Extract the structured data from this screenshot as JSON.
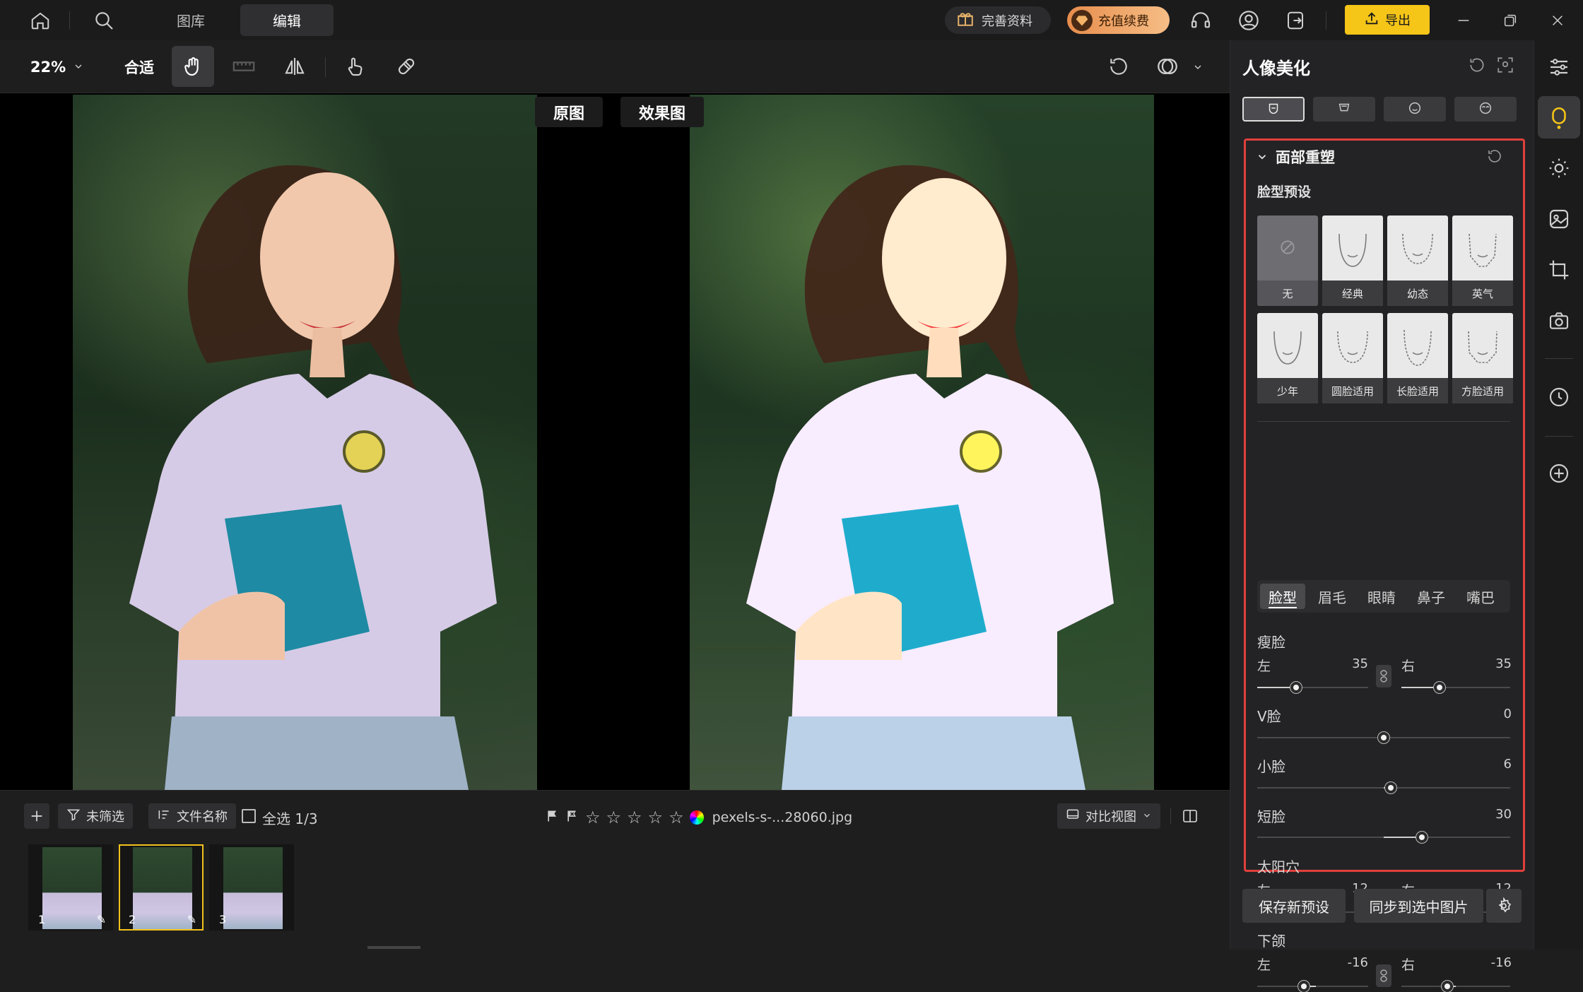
{
  "topbar": {
    "tabs": [
      "图库",
      "编辑"
    ],
    "complete_profile": "完善资料",
    "recharge": "充值续费",
    "export": "导出",
    "accent_export": "#f5c518",
    "accent_recharge": "#f0a35a"
  },
  "toolbar": {
    "zoom": "22%",
    "fit": "合适"
  },
  "canvas": {
    "original_label": "原图",
    "effect_label": "效果图"
  },
  "strip": {
    "filter": "未筛选",
    "sort": "文件名称",
    "select_all": "全选 1/3",
    "filename": "pexels-s-...28060.jpg",
    "compare_view": "对比视图",
    "thumbnails": [
      {
        "num": "1"
      },
      {
        "num": "2"
      },
      {
        "num": "3"
      }
    ]
  },
  "panel": {
    "title": "人像美化",
    "section": "面部重塑",
    "preset_heading": "脸型预设",
    "presets": [
      "无",
      "经典",
      "幼态",
      "英气",
      "少年",
      "圆脸适用",
      "长脸适用",
      "方脸适用"
    ],
    "subtabs": [
      "脸型",
      "眉毛",
      "眼睛",
      "鼻子",
      "嘴巴"
    ],
    "sliders": {
      "thin_face": {
        "title": "瘦脸",
        "left": "左",
        "left_val": "35",
        "right": "右",
        "right_val": "35"
      },
      "v_face": {
        "title": "V脸",
        "val": "0"
      },
      "small_face": {
        "title": "小脸",
        "val": "6"
      },
      "short_face": {
        "title": "短脸",
        "val": "30"
      },
      "temple": {
        "title": "太阳穴",
        "left": "左",
        "left_val": "12",
        "right": "右",
        "right_val": "12"
      },
      "jaw": {
        "title": "下颌",
        "left": "左",
        "left_val": "-16",
        "right": "右",
        "right_val": "-16"
      }
    },
    "save_preset": "保存新预设",
    "sync": "同步到选中图片",
    "highlight_color": "#e0403c"
  }
}
